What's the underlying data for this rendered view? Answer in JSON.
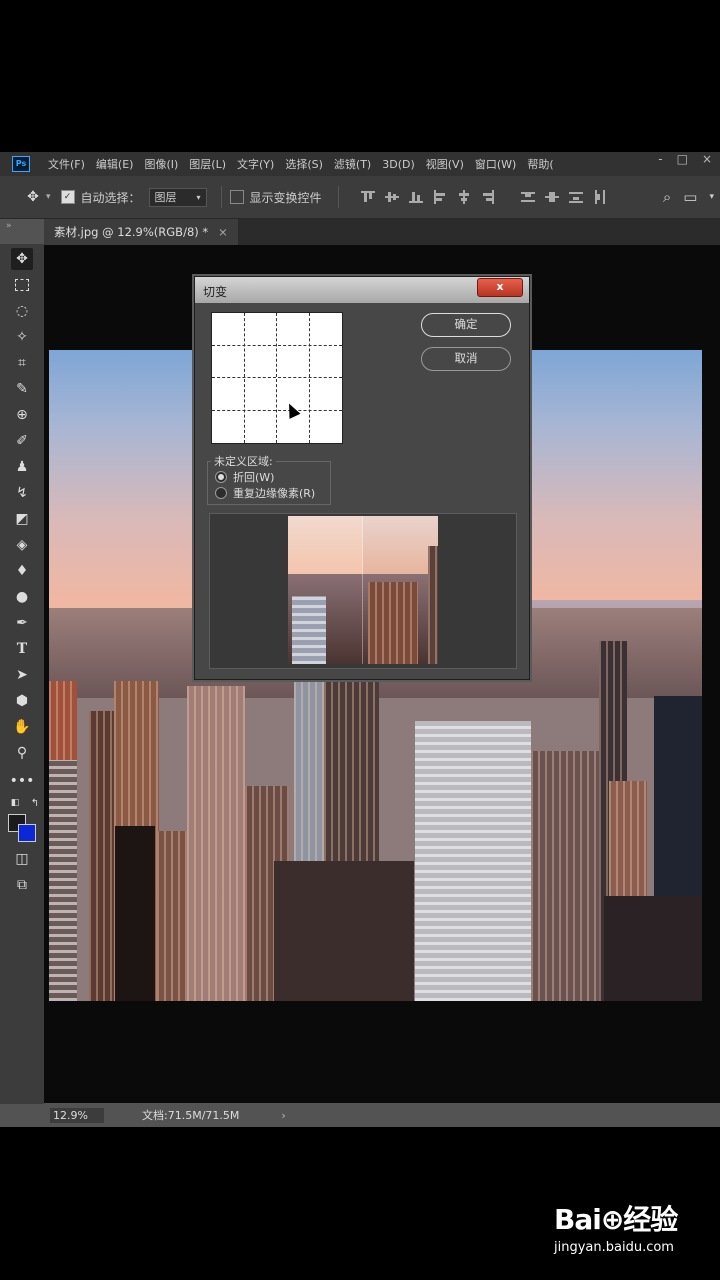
{
  "app": {
    "logo": "Ps"
  },
  "menu": [
    "文件(F)",
    "编辑(E)",
    "图像(I)",
    "图层(L)",
    "文字(Y)",
    "选择(S)",
    "滤镜(T)",
    "3D(D)",
    "视图(V)",
    "窗口(W)",
    "帮助("
  ],
  "window_controls": {
    "minimize": "-",
    "maximize": "□",
    "close": "×"
  },
  "options": {
    "auto_select_label": "自动选择：",
    "auto_select_checked": true,
    "auto_select_value": "图层",
    "show_transform_label": "显示变换控件",
    "show_transform_checked": false
  },
  "tab": {
    "title": "素材.jpg @ 12.9%(RGB/8) *",
    "close": "×"
  },
  "dialog": {
    "title": "切变",
    "close": "x",
    "ok_label": "确定",
    "cancel_label": "取消",
    "undefined_area_label": "未定义区域:",
    "options": [
      {
        "label": "折回(W)",
        "selected": true
      },
      {
        "label": "重复边缘像素(R)",
        "selected": false
      }
    ]
  },
  "status": {
    "zoom": "12.9%",
    "doc": "文档:71.5M/71.5M",
    "arrow": "›"
  },
  "watermark": {
    "logo": "Bai⊕经验",
    "url": "jingyan.baidu.com"
  },
  "colors": {
    "foreground": "#1b1b1b",
    "background": "#0a28d8",
    "accent": "#31a8ff"
  }
}
